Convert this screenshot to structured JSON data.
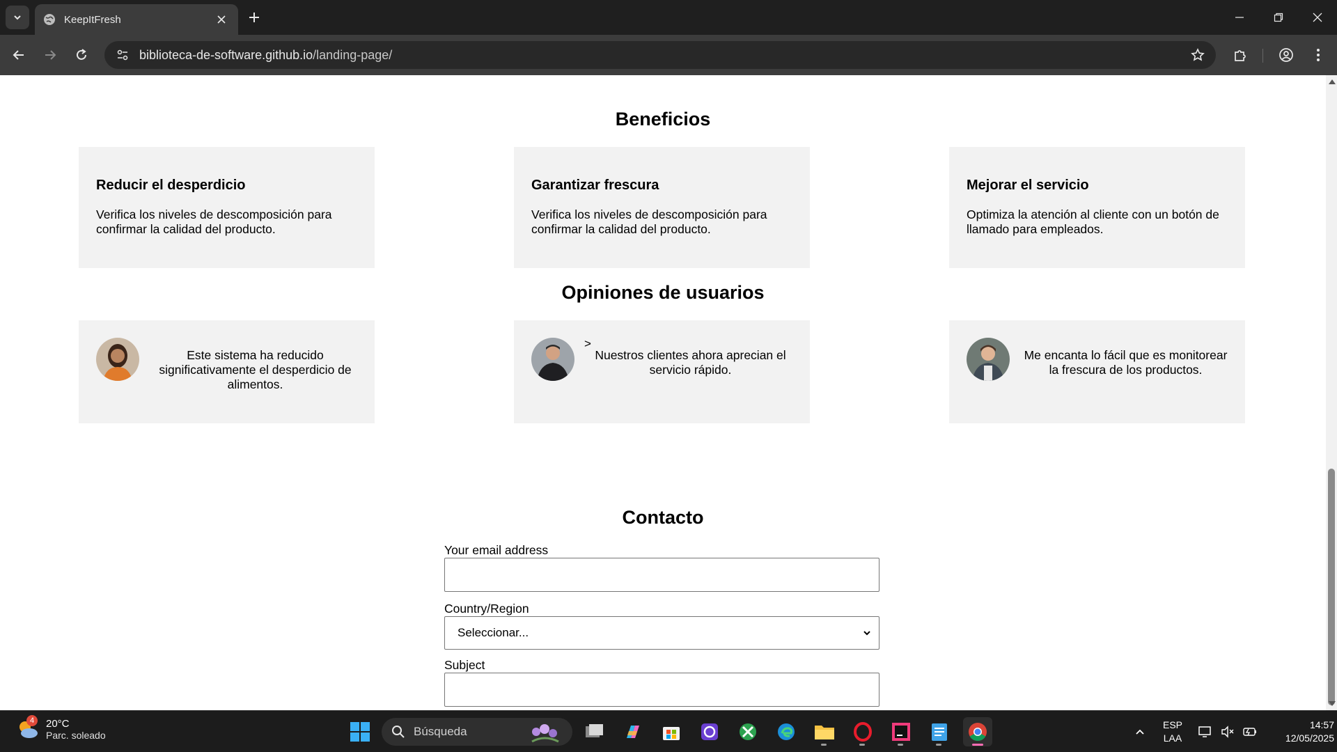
{
  "browser": {
    "tab_title": "KeepItFresh",
    "url_host": "biblioteca-de-software.github.io",
    "url_path": "/landing-page/"
  },
  "page": {
    "benefits": {
      "title": "Beneficios",
      "cards": [
        {
          "title": "Reducir el desperdicio",
          "text": "Verifica los niveles de descomposición para confirmar la calidad del producto."
        },
        {
          "title": "Garantizar frescura",
          "text": "Verifica los niveles de descomposición para confirmar la calidad del producto."
        },
        {
          "title": "Mejorar el servicio",
          "text": "Optimiza la atención al cliente con un botón de llamado para empleados."
        }
      ]
    },
    "reviews": {
      "title": "Opiniones de usuarios",
      "cards": [
        {
          "text": "Este sistema ha reducido significativamente el desperdicio de alimentos."
        },
        {
          "text": "Nuestros clientes ahora aprecian el servicio rápido.",
          "mark": ">"
        },
        {
          "text": "Me encanta lo fácil que es monitorear la frescura de los productos."
        }
      ]
    },
    "contact": {
      "title": "Contacto",
      "email_label": "Your email address",
      "country_label": "Country/Region",
      "country_selected": "Seleccionar...",
      "subject_label": "Subject"
    }
  },
  "taskbar": {
    "weather_badge": "4",
    "weather_temp": "20°C",
    "weather_desc": "Parc. soleado",
    "search_label": "Búsqueda",
    "lang_top": "ESP",
    "lang_bottom": "LAA",
    "time": "14:57",
    "date": "12/05/2025"
  },
  "colors": {
    "card_bg": "#f2f2f2",
    "chrome_dark": "#1f1f1f",
    "chrome_toolbar": "#3c3c3c"
  }
}
